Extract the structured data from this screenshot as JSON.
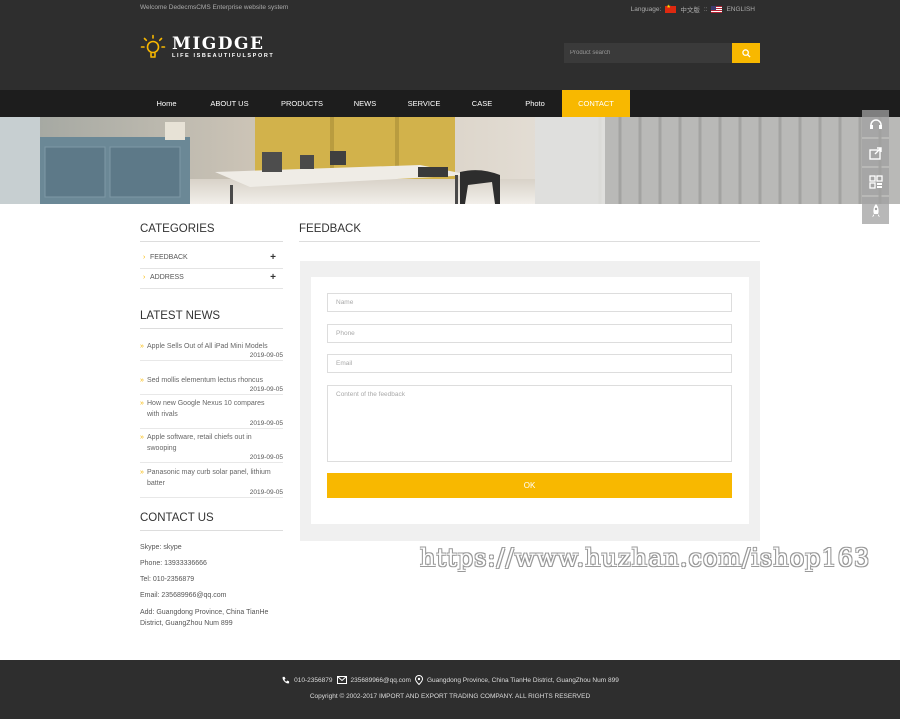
{
  "topbar": {
    "welcome": "Welcome DedecmsCMS Enterprise website system",
    "language_label": "Language:",
    "lang_cn": "中文版",
    "lang_sep": "::",
    "lang_en": "ENGLISH"
  },
  "header": {
    "logo_name": "MIGDGE",
    "logo_slogan": "LIFE ISBEAUTIFULSPORT",
    "search_placeholder": "Product search"
  },
  "nav": {
    "items": [
      {
        "label": "Home"
      },
      {
        "label": "ABOUT US"
      },
      {
        "label": "PRODUCTS"
      },
      {
        "label": "NEWS"
      },
      {
        "label": "SERVICE"
      },
      {
        "label": "CASE"
      },
      {
        "label": "Photo"
      },
      {
        "label": "CONTACT"
      }
    ],
    "active_index": 7
  },
  "sidebar": {
    "categories_title": "CATEGORIES",
    "categories": [
      {
        "label": "FEEDBACK"
      },
      {
        "label": "ADDRESS"
      }
    ],
    "news_title": "LATEST NEWS",
    "news": [
      {
        "title": "Apple Sells Out of All iPad Mini Models",
        "date": "2019-09-05"
      },
      {
        "title": "Sed mollis elementum lectus rhoncus",
        "date": "2019-09-05"
      },
      {
        "title": "How new Google Nexus 10 compares with rivals",
        "date": "2019-09-05"
      },
      {
        "title": "Apple software, retail chiefs out in swooping",
        "date": "2019-09-05"
      },
      {
        "title": "Panasonic may curb solar panel, lithium batter",
        "date": "2019-09-05"
      }
    ],
    "contact_title": "CONTACT US",
    "contact": {
      "skype": "Skype: skype",
      "phone": "Phone: 13933336666",
      "tel": "Tel: 010-2356879",
      "email": "Email: 235689966@qq.com",
      "address": "Add: Guangdong Province, China TianHe District, GuangZhou Num 899"
    }
  },
  "main": {
    "title": "FEEDBACK",
    "form": {
      "name_placeholder": "Name",
      "phone_placeholder": "Phone",
      "email_placeholder": "Email",
      "content_placeholder": "Content of the feedback",
      "submit_label": "OK"
    }
  },
  "watermark": "https://www.huzhan.com/ishop163",
  "footer": {
    "tel": "010-2356879",
    "email": "235689966@qq.com",
    "address": "Guangdong Province, China TianHe District, GuangZhou Num 899",
    "copyright": "Copyright © 2002-2017 IMPORT AND EXPORT TRADING COMPANY. ALL RIGHTS RESERVED"
  },
  "colors": {
    "accent": "#f8b800",
    "dark": "#2e2e2e",
    "nav": "#1d1d1d"
  }
}
